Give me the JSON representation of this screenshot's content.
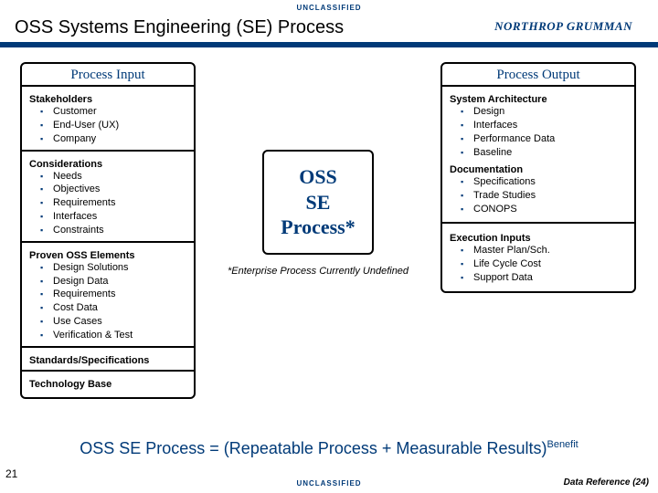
{
  "classification": "UNCLASSIFIED",
  "header": {
    "title": "OSS Systems Engineering (SE) Process",
    "logo": "NORTHROP GRUMMAN"
  },
  "input": {
    "title": "Process Input",
    "stakeholders": {
      "label": "Stakeholders",
      "items": [
        "Customer",
        "End-User (UX)",
        "Company"
      ]
    },
    "considerations": {
      "label": "Considerations",
      "items": [
        "Needs",
        "Objectives",
        "Requirements",
        "Interfaces",
        "Constraints"
      ]
    },
    "proven": {
      "label": "Proven OSS Elements",
      "items": [
        "Design Solutions",
        "Design Data",
        "Requirements",
        "Cost Data",
        "Use Cases",
        "Verification & Test"
      ]
    },
    "standards": {
      "label": "Standards/Specifications"
    },
    "techbase": {
      "label": "Technology Base"
    }
  },
  "middle": {
    "box_l1": "OSS",
    "box_l2": "SE",
    "box_l3": "Process*",
    "note": "*Enterprise Process Currently Undefined"
  },
  "output": {
    "title": "Process Output",
    "arch": {
      "label": "System Architecture",
      "items": [
        "Design",
        "Interfaces",
        "Performance Data",
        "Baseline"
      ]
    },
    "doc": {
      "label": "Documentation",
      "items": [
        "Specifications",
        "Trade Studies",
        "CONOPS"
      ]
    },
    "exec": {
      "label": "Execution Inputs",
      "items": [
        "Master Plan/Sch.",
        "Life Cycle Cost",
        "Support Data"
      ]
    }
  },
  "formula": {
    "base": "OSS SE Process = (Repeatable Process + Measurable Results)",
    "sup": "Benefit"
  },
  "footer": {
    "page": "21",
    "ref": "Data Reference (24)"
  }
}
